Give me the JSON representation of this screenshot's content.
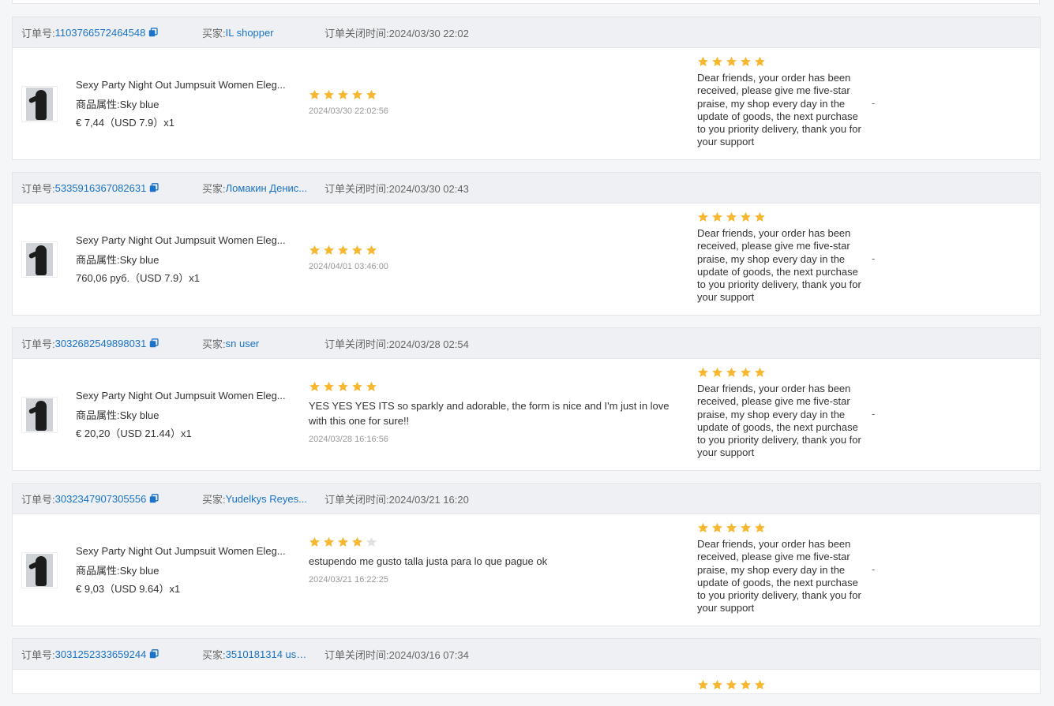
{
  "labels": {
    "order_no": "订单号:",
    "buyer": "买家:",
    "close_time": "订单关闭时间:",
    "attr": "商品属性:"
  },
  "colors": {
    "link": "#1a73c8",
    "star_on": "#f7b731",
    "star_off": "#e2e2e2"
  },
  "orders": [
    {
      "order_no": "1103766572464548",
      "buyer": "IL shopper",
      "close_time": "2024/03/30 22:02",
      "product": {
        "title": "Sexy Party Night Out Jumpsuit Women Eleg...",
        "attr_value": "Sky blue",
        "price": "€ 7,44（USD  7.9）x1"
      },
      "review": {
        "stars": 5,
        "text": "",
        "date": "2024/03/30 22:02:56"
      },
      "reply": {
        "stars": 5,
        "text": "Dear friends, your order has been received, please give me five-star praise, my shop every day in the update of goods, the next purchase to you priority delivery, thank you for your support"
      },
      "extra": "-"
    },
    {
      "order_no": "5335916367082631",
      "buyer": "Ломакин Денис...",
      "close_time": "2024/03/30 02:43",
      "product": {
        "title": "Sexy Party Night Out Jumpsuit Women Eleg...",
        "attr_value": "Sky blue",
        "price": "760,06 руб.（USD  7.9）x1"
      },
      "review": {
        "stars": 5,
        "text": "",
        "date": "2024/04/01 03:46:00"
      },
      "reply": {
        "stars": 5,
        "text": "Dear friends, your order has been received, please give me five-star praise, my shop every day in the update of goods, the next purchase to you priority delivery, thank you for your support"
      },
      "extra": "-"
    },
    {
      "order_no": "3032682549898031",
      "buyer": "sn user",
      "close_time": "2024/03/28 02:54",
      "product": {
        "title": "Sexy Party Night Out Jumpsuit Women Eleg...",
        "attr_value": "Sky blue",
        "price": "€ 20,20（USD  21.44）x1"
      },
      "review": {
        "stars": 5,
        "text": "YES YES YES ITS so sparkly and adorable, the form is nice and I'm just in love with this one for sure!!",
        "date": "2024/03/28 16:16:56"
      },
      "reply": {
        "stars": 5,
        "text": "Dear friends, your order has been received, please give me five-star praise, my shop every day in the update of goods, the next purchase to you priority delivery, thank you for your support"
      },
      "extra": "-"
    },
    {
      "order_no": "3032347907305556",
      "buyer": "Yudelkys Reyes...",
      "close_time": "2024/03/21 16:20",
      "product": {
        "title": "Sexy Party Night Out Jumpsuit Women Eleg...",
        "attr_value": "Sky blue",
        "price": "€ 9,03（USD  9.64）x1"
      },
      "review": {
        "stars": 4,
        "text": "estupendo me gusto talla justa para lo que pague ok",
        "date": "2024/03/21 16:22:25"
      },
      "reply": {
        "stars": 5,
        "text": "Dear friends, your order has been received, please give me five-star praise, my shop every day in the update of goods, the next purchase to you priority delivery, thank you for your support"
      },
      "extra": "-"
    },
    {
      "order_no": "3031252333659244",
      "buyer": "3510181314 use...",
      "close_time": "2024/03/16 07:34",
      "partial": true,
      "reply": {
        "stars": 5
      }
    }
  ]
}
